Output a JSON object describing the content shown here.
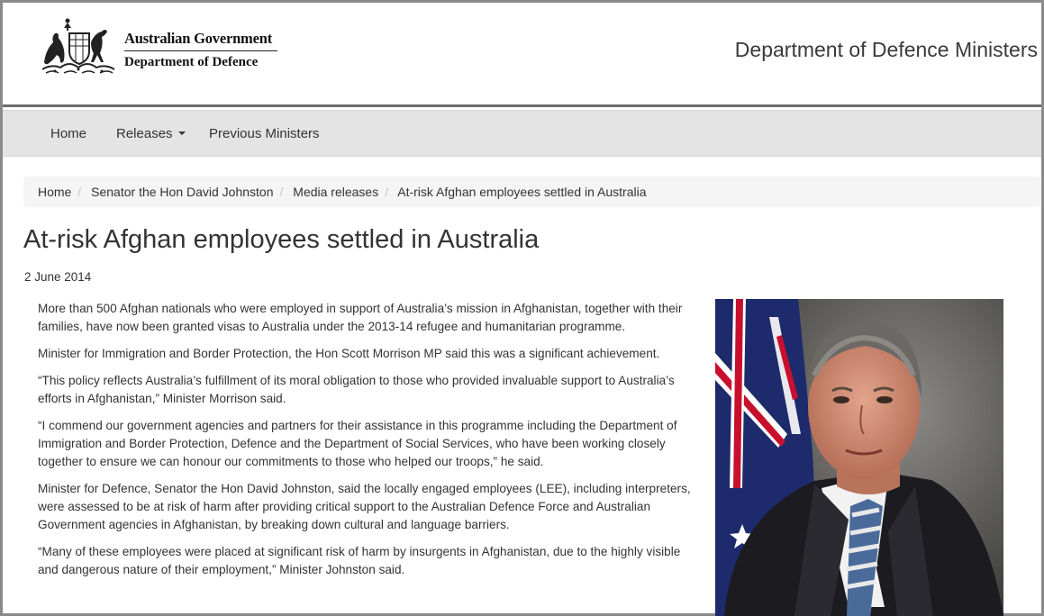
{
  "header": {
    "gov_name": "Australian Government",
    "dept_name": "Department of Defence",
    "site_title": "Department of Defence Ministers"
  },
  "nav": {
    "items": [
      {
        "label": "Home"
      },
      {
        "label": "Releases",
        "has_dropdown": true
      },
      {
        "label": "Previous Ministers"
      }
    ]
  },
  "breadcrumb": {
    "items": [
      "Home",
      "Senator the Hon David Johnston",
      "Media releases",
      "At-risk Afghan employees settled in Australia"
    ]
  },
  "article": {
    "title": "At-risk Afghan employees settled in Australia",
    "date": "2 June 2014",
    "paragraphs": [
      "More than 500 Afghan nationals who were employed in support of Australia’s mission in Afghanistan, together with their families, have now been granted visas to Australia under the 2013-14 refugee and humanitarian programme.",
      "Minister for Immigration and Border Protection, the Hon Scott Morrison MP said this was a significant achievement.",
      "“This policy reflects Australia’s fulfillment of its moral obligation to those who provided invaluable support to Australia’s efforts in Afghanistan,” Minister Morrison said.",
      "“I commend our government agencies and partners for their assistance in this programme including the Department of Immigration and Border Protection, Defence and the Department of Social Services, who have been working closely together to ensure we can honour our commitments to those who helped our troops,” he said.",
      "Minister for Defence, Senator the Hon David Johnston, said the locally engaged employees (LEE), including interpreters, were assessed to be at risk of harm after providing critical support to the Australian Defence Force and Australian Government agencies in Afghanistan, by breaking down cultural and language barriers.",
      "“Many of these employees were placed at significant risk of harm by insurgents in Afghanistan, due to the highly visible and dangerous nature of their employment,” Minister Johnston said."
    ]
  },
  "colors": {
    "navbar_bg": "#e4e4e4",
    "breadcrumb_bg": "#f5f5f5",
    "text": "#333333",
    "frame_border": "#8a8a8a"
  },
  "icons": {
    "crest": "coat-of-arms-icon",
    "dropdown": "caret-down-icon"
  }
}
